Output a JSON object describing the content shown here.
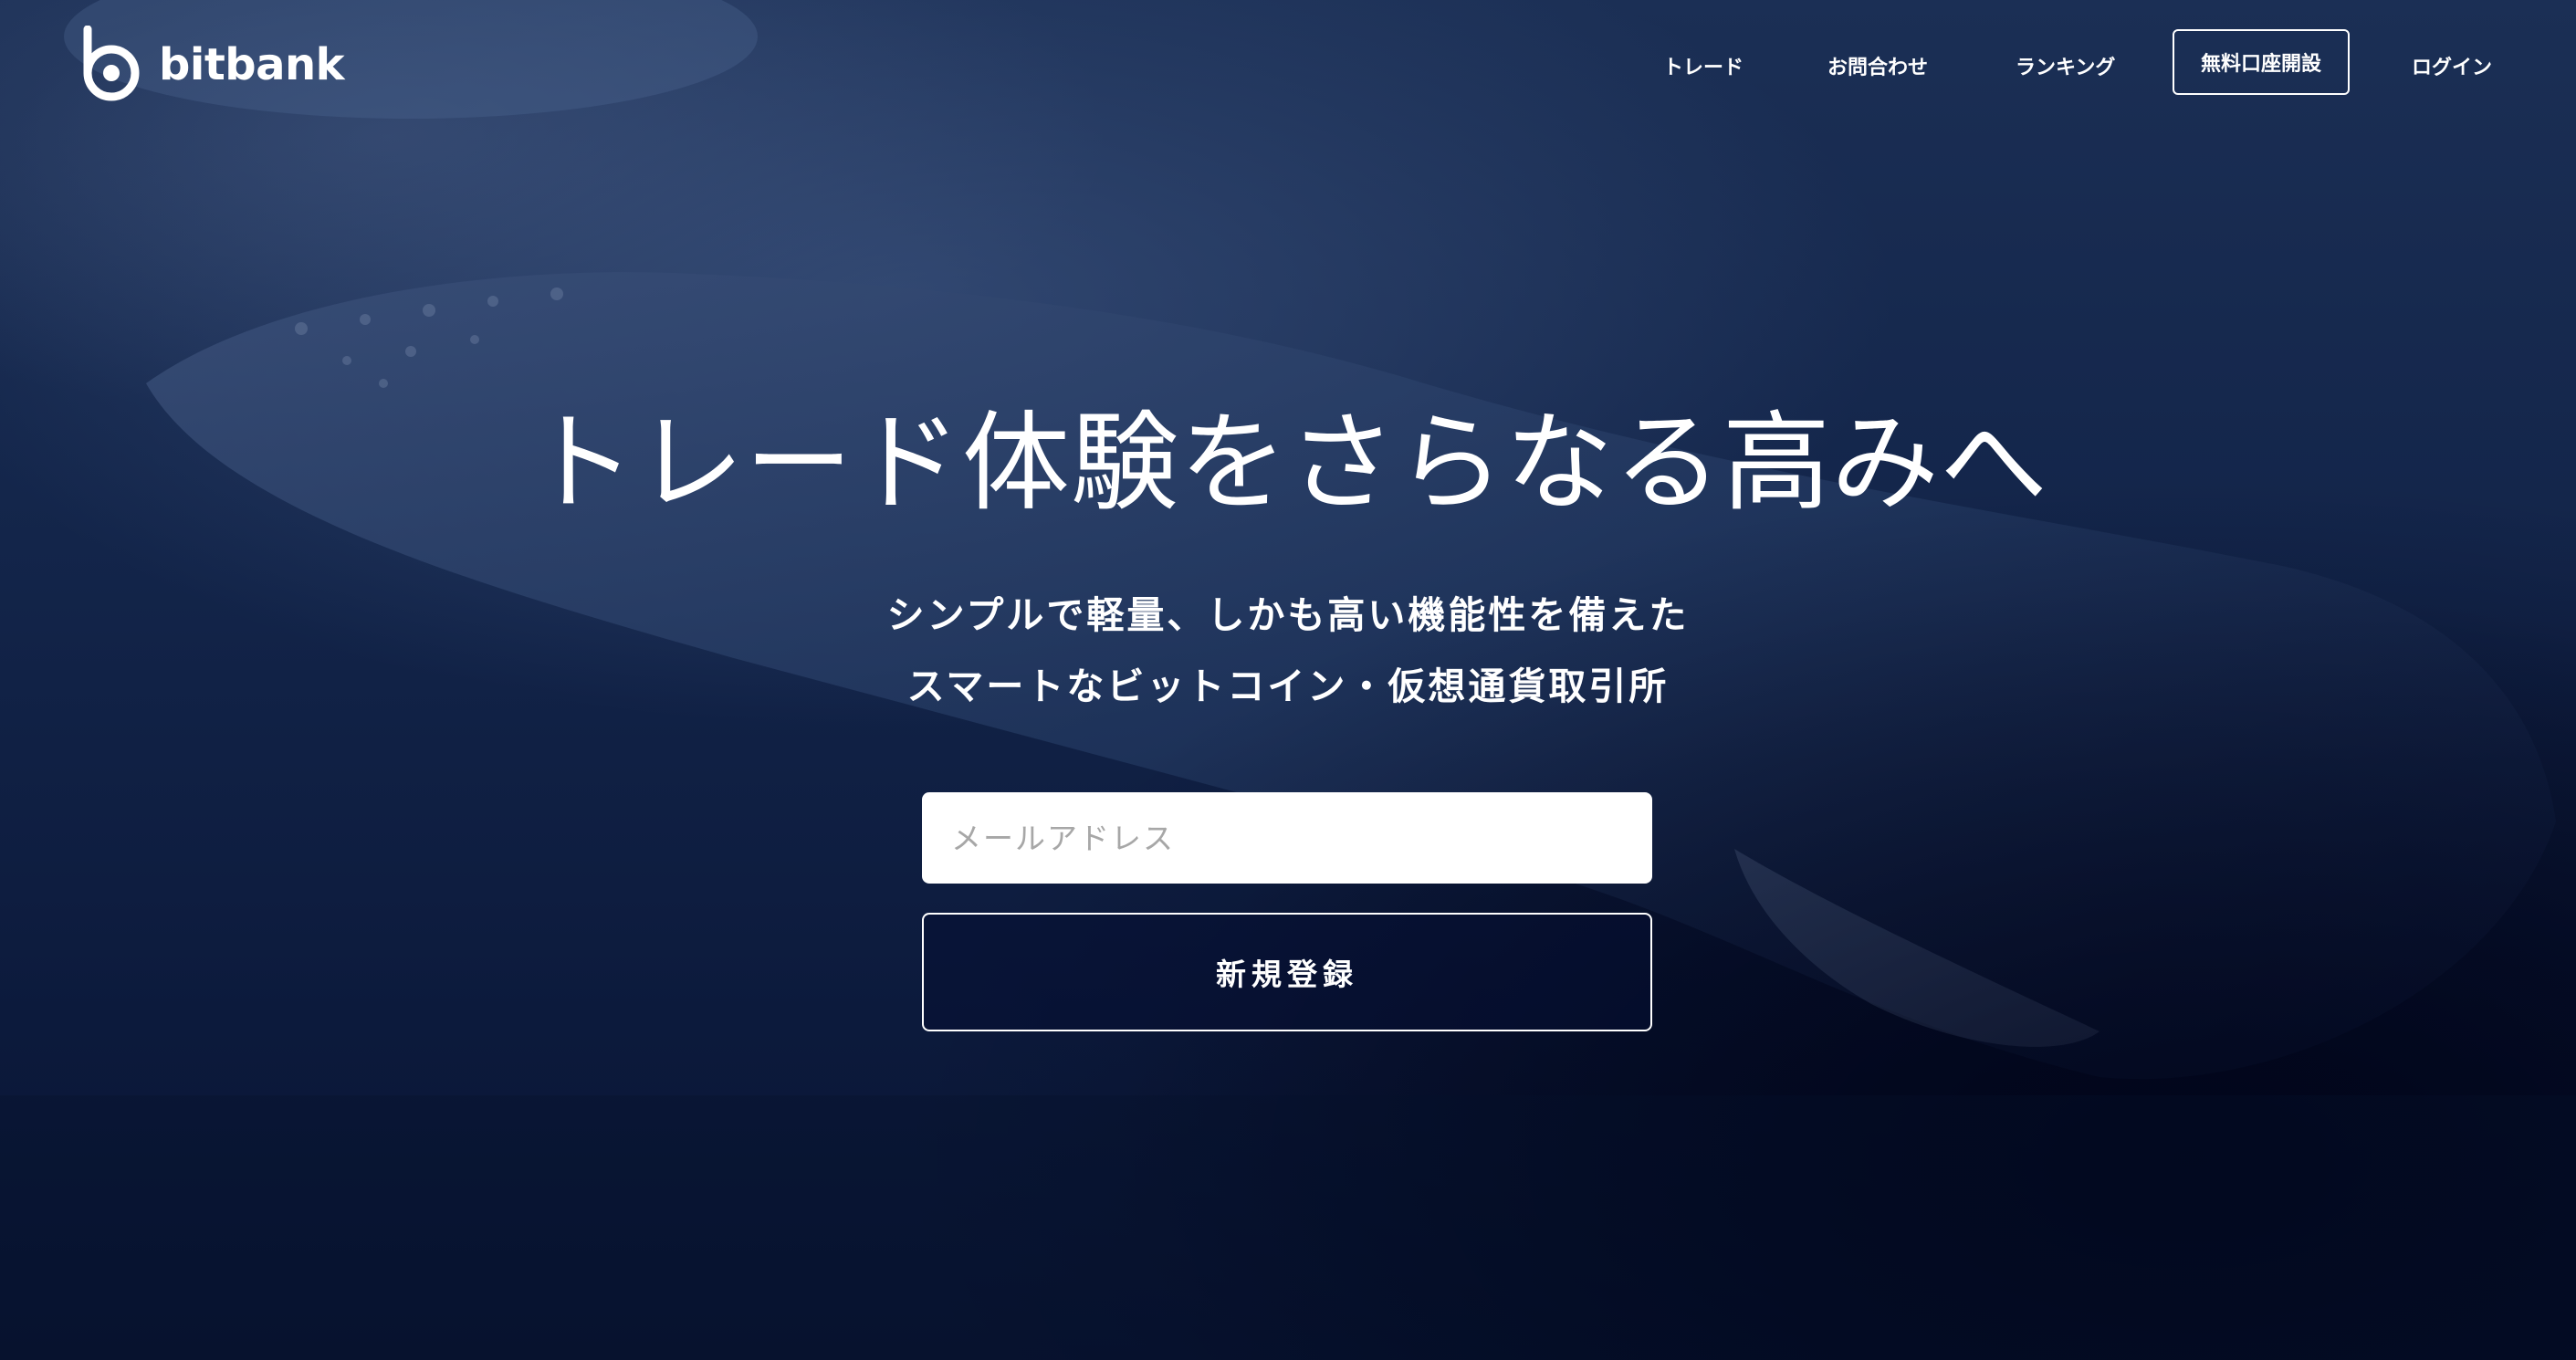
{
  "brand": {
    "name": "bitbank"
  },
  "nav": {
    "trade": "トレード",
    "contact": "お問合わせ",
    "ranking": "ランキング",
    "open_account": "無料口座開設",
    "login": "ログイン"
  },
  "hero": {
    "headline": "トレード体験をさらなる高みへ",
    "subline1": "シンプルで軽量、しかも高い機能性を備えた",
    "subline2": "スマートなビットコイン・仮想通貨取引所"
  },
  "signup_form": {
    "email_placeholder": "メールアドレス",
    "email_value": "",
    "submit_label": "新規登録"
  },
  "colors": {
    "background": "#13254a",
    "text": "#ffffff",
    "input_background": "#ffffff",
    "placeholder": "#a7a7a7"
  },
  "icons": [
    "bitbank-logo-icon"
  ]
}
